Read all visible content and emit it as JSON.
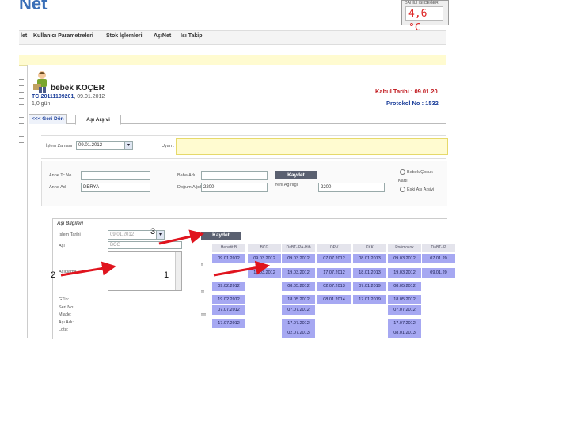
{
  "header": {
    "logo_text": "Net",
    "temperature_caption": "DAHİLİ ISI DEĞER",
    "temperature_value": "4,6 °C"
  },
  "menu": {
    "items": [
      "let",
      "Kullanıcı Parametreleri",
      "Stok İşlemleri",
      "AşıNet",
      "Isı Takip"
    ]
  },
  "patient": {
    "name": "bebek KOÇER",
    "tc_label": "TC:",
    "tc_value": "20111109201",
    "tc_suffix": ", 09.01.2012",
    "age": "1,0 gün",
    "admission_date": "Kabul Tarihi : 09.01.20",
    "protocol_no": "Protokol No : 1532"
  },
  "tabs": {
    "back": "<<< Geri Dön",
    "vaccine_archive": "Aşı Arşivi"
  },
  "operation": {
    "date_label": "İşlem Zamanı",
    "date_value": "09.01.2012",
    "warning_label": "Uyarı :"
  },
  "parents": {
    "mother_tc_label": "Anne Tc No",
    "mother_name_label": "Anne Adı",
    "mother_name_value": "DERYA",
    "father_name_label": "Baba Adı",
    "birth_weight_label": "Doğum Ağırlığı",
    "birth_weight_value": "2200",
    "new_weight_label": "Yeni Ağırlığı",
    "new_weight_value": "2200",
    "save_label": "Kaydet",
    "radio_baby": "Bebek/Çocuk",
    "card_label": "Kartı",
    "radio_old": "Eski Aşı Arşivi"
  },
  "vaccine_info": {
    "title": "Aşı Bilgileri",
    "date_label": "İşlem Tarihi",
    "date_value": "09.01.2012",
    "vaccine_label": "Aşı",
    "vaccine_value": "BCG",
    "desc_label": "Açıklama",
    "save_label": "Kaydet",
    "gtin_label": "GTin:",
    "serial_label": "Seri No:",
    "expiry_label": "Miade:",
    "name_label": "Aşı Adı:",
    "lot_label": "Lotu:"
  },
  "schedule": {
    "columns": [
      "Hepatit B",
      "BCG",
      "DaBT-İPA-Hib",
      "OPV",
      "KKK",
      "Pnömokok",
      "DaBT-İP"
    ],
    "row_labels": [
      "I",
      "II",
      "III"
    ],
    "cells": [
      [
        "09.01.2012",
        "09.03.2012",
        "09.03.2012",
        "07.07.2012",
        "08.01.2013",
        "09.03.2012",
        "07.01.20"
      ],
      [
        "",
        "19.03.2012",
        "19.03.2012",
        "17.07.2012",
        "18.01.2013",
        "19.03.2012",
        "09.01.20"
      ],
      [
        "09.02.2012",
        "",
        "08.05.2012",
        "02.07.2013",
        "07.01.2019",
        "08.05.2012",
        ""
      ],
      [
        "19.02.2012",
        "",
        "18.05.2012",
        "08.01.2014",
        "17.01.2019",
        "18.05.2012",
        ""
      ],
      [
        "07.07.2012",
        "",
        "07.07.2012",
        "",
        "",
        "07.07.2012",
        ""
      ],
      [
        "17.07.2012",
        "",
        "17.07.2012",
        "",
        "",
        "17.07.2012",
        ""
      ],
      [
        "",
        "",
        "02.07.2013",
        "",
        "",
        "08.01.2013",
        ""
      ]
    ]
  },
  "annotations": {
    "one": "1",
    "two": "2",
    "three": "3",
    "arrow_color": "#e0141e"
  }
}
